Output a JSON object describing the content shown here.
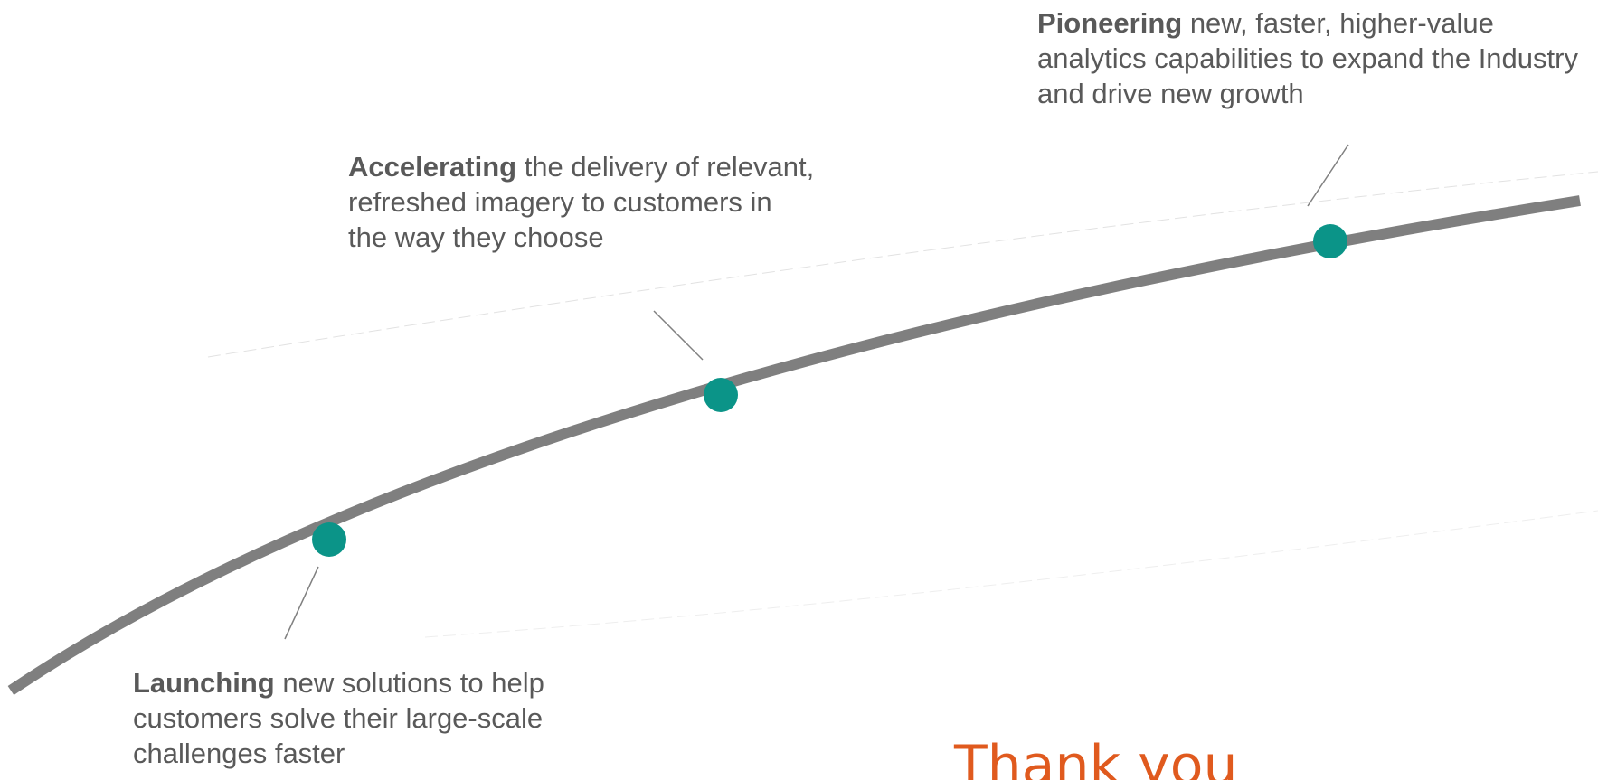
{
  "colors": {
    "text": "#595959",
    "curve": "#7f7f7f",
    "milestone_dot": "#0b9488",
    "title": "#e05a1e"
  },
  "milestones": [
    {
      "keyword": "Launching",
      "text": " new solutions to help customers solve their large-scale challenges faster"
    },
    {
      "keyword": "Accelerating",
      "text": " the delivery of relevant, refreshed imagery to customers in the way they choose"
    },
    {
      "keyword": "Pioneering",
      "text": " new, faster, higher-value analytics capabilities to expand the Industry and drive new growth"
    }
  ],
  "closing": {
    "title": "Thank you"
  }
}
